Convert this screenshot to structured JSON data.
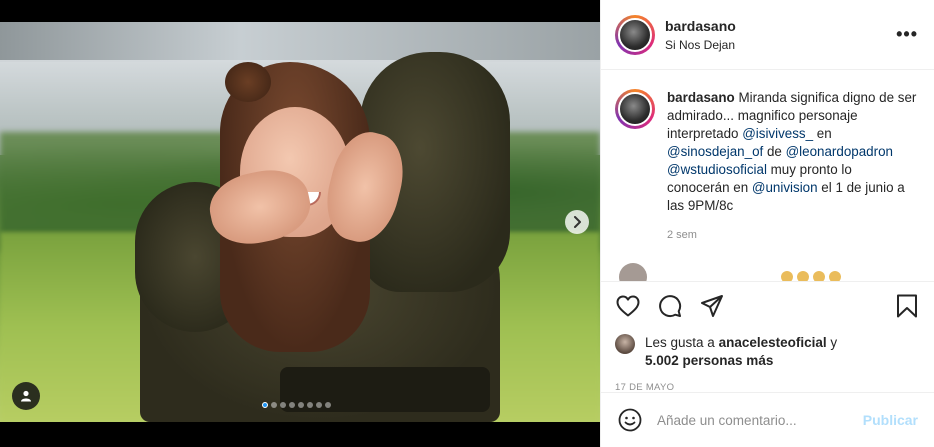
{
  "post": {
    "username": "bardasano",
    "location": "Si Nos Dejan",
    "caption": {
      "username": "bardasano",
      "parts": [
        {
          "text": " Miranda significa digno de ser admirado... magnifico personaje interpretado "
        },
        {
          "mention": "@isivivess_"
        },
        {
          "text": " en "
        },
        {
          "mention": "@sinosdejan_of"
        },
        {
          "text": " de "
        },
        {
          "mention": "@leonardopadron"
        },
        {
          "text": " "
        },
        {
          "mention": "@wstudiosoficial"
        },
        {
          "text": " muy pronto lo conocerán en "
        },
        {
          "mention": "@univision"
        },
        {
          "text": " el 1 de junio a las 9PM/8c"
        }
      ],
      "time_ago": "2 sem"
    },
    "likes": {
      "prefix": "Les gusta a ",
      "user": "anacelesteoficial",
      "mid": " y",
      "count": "5.002 personas más"
    },
    "date": "17 DE MAYO",
    "carousel": {
      "slides": 8,
      "active_index": 0
    }
  },
  "comment_box": {
    "placeholder": "Añade un comentario...",
    "post_label": "Publicar"
  },
  "icons": {
    "more": "more-options-icon",
    "like": "heart-icon",
    "comment": "comment-bubble-icon",
    "share": "paper-plane-icon",
    "save": "bookmark-icon",
    "emoji": "smiley-icon",
    "next": "chevron-right-icon",
    "tag": "user-tag-icon"
  },
  "colors": {
    "mention": "#00376b",
    "muted": "#8e8e8e",
    "publish_disabled": "#b2dffc",
    "carousel_active": "#2196f3"
  }
}
